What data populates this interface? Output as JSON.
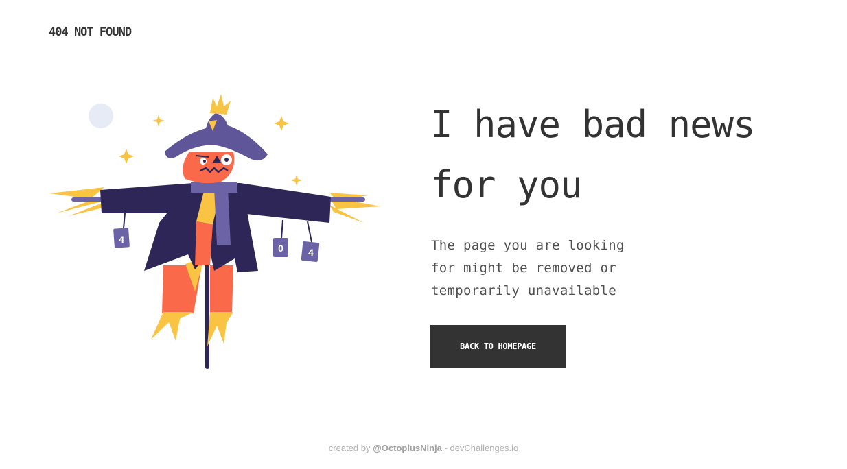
{
  "header": {
    "brand": "404 NOT FOUND"
  },
  "main": {
    "headline_line1": "I have bad news",
    "headline_line2": "for you",
    "message_line1": "The page you are looking",
    "message_line2": "for might be removed or",
    "message_line3": "temporarily unavailable",
    "cta_label": "BACK TO HOMEPAGE"
  },
  "illustration": {
    "tag_left": "4",
    "tag_middle": "0",
    "tag_right": "4"
  },
  "footer": {
    "prefix": "created by ",
    "handle": "@OctoplusNinja",
    "suffix": " - devChallenges.io"
  },
  "colors": {
    "text": "#333333",
    "button_bg": "#333333",
    "button_text": "#ffffff",
    "coat": "#2e2657",
    "hat": "#5f5699",
    "skin": "#f9694a",
    "straw": "#f9c344",
    "moon": "#e6ebf5"
  }
}
